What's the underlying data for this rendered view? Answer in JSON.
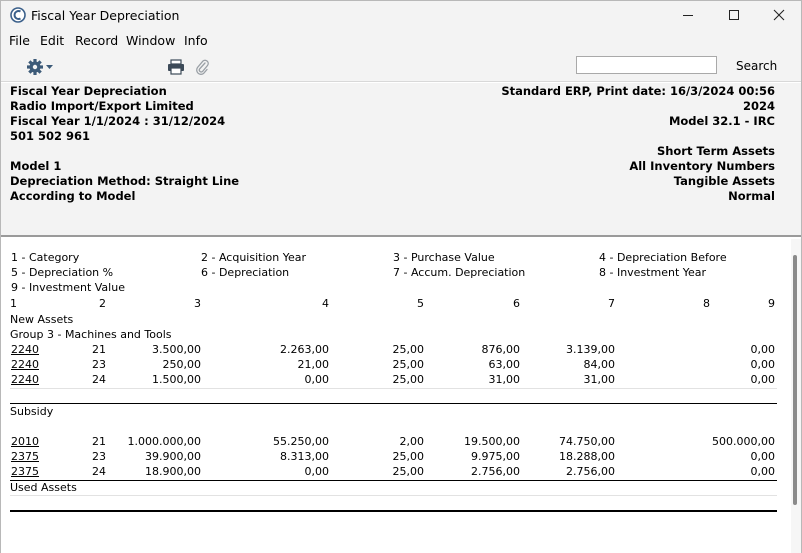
{
  "window": {
    "title": "Fiscal Year Depreciation"
  },
  "menu": [
    "File",
    "Edit",
    "Record",
    "Window",
    "Info"
  ],
  "toolbar": {
    "search_placeholder": "",
    "search_label": "Search"
  },
  "header": {
    "left": [
      "Fiscal Year Depreciation",
      "Radio Import/Export Limited",
      "Fiscal Year 1/1/2024 : 31/12/2024",
      "501 502 961",
      "Model 1",
      "Depreciation Method: Straight Line",
      "According to Model"
    ],
    "right": [
      "Standard ERP, Print date: 16/3/2024 00:56",
      "2024",
      "Model 32.1 - IRC",
      "Short Term Assets",
      "All Inventory Numbers",
      "Tangible Assets",
      "Normal"
    ]
  },
  "legend": [
    "1 - Category",
    "2 - Acquisition Year",
    "3 - Purchase Value",
    "4 - Depreciation Before",
    "5 - Depreciation %",
    "6 - Depreciation",
    "7 - Accum. Depreciation",
    "8 - Investment Year",
    "9 - Investment Value"
  ],
  "columns": [
    "1",
    "2",
    "3",
    "4",
    "5",
    "6",
    "7",
    "8",
    "9"
  ],
  "sections": {
    "new_assets": "New Assets",
    "group": "Group 3 - Machines and Tools",
    "subsidy": "Subsidy",
    "used_assets": "Used Assets"
  },
  "rows": [
    [
      "2240",
      "21",
      "3.500,00",
      "2.263,00",
      "25,00",
      "876,00",
      "3.139,00",
      "",
      "0,00"
    ],
    [
      "2240",
      "23",
      "250,00",
      "21,00",
      "25,00",
      "63,00",
      "84,00",
      "",
      "0,00"
    ],
    [
      "2240",
      "24",
      "1.500,00",
      "0,00",
      "25,00",
      "31,00",
      "31,00",
      "",
      "0,00"
    ]
  ],
  "subsidy_rows": [
    [
      "2010",
      "21",
      "1.000.000,00",
      "55.250,00",
      "2,00",
      "19.500,00",
      "74.750,00",
      "",
      "500.000,00"
    ],
    [
      "2375",
      "23",
      "39.900,00",
      "8.313,00",
      "25,00",
      "9.975,00",
      "18.288,00",
      "",
      "0,00"
    ],
    [
      "2375",
      "24",
      "18.900,00",
      "0,00",
      "25,00",
      "2.756,00",
      "2.756,00",
      "",
      "0,00"
    ]
  ]
}
